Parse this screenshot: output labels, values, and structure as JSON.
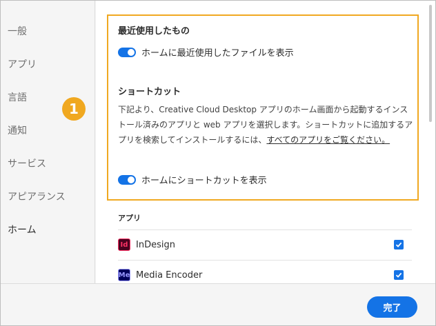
{
  "sidebar": {
    "items": [
      {
        "label": "一般"
      },
      {
        "label": "アプリ"
      },
      {
        "label": "言語"
      },
      {
        "label": "通知"
      },
      {
        "label": "サービス"
      },
      {
        "label": "アピアランス"
      },
      {
        "label": "ホーム",
        "active": true
      }
    ]
  },
  "callout_badge": "1",
  "recent": {
    "title": "最近使用したもの",
    "toggle_label": "ホームに最近使用したファイルを表示",
    "toggle_on": true
  },
  "shortcuts": {
    "title": "ショートカット",
    "description": "下記より、Creative Cloud Desktop アプリのホーム画面から起動するインストール済みのアプリと web アプリを選択します。ショートカットに追加するアプリを検索してインストールするには、",
    "link_text": "すべてのアプリをご覧ください。",
    "toggle_label": "ホームにショートカットを表示",
    "toggle_on": true
  },
  "apps": {
    "header": "アプリ",
    "items": [
      {
        "icon_text": "Id",
        "name": "InDesign",
        "checked": true
      },
      {
        "icon_text": "Me",
        "name": "Media Encoder",
        "checked": true
      }
    ]
  },
  "footer": {
    "done_label": "完了"
  },
  "colors": {
    "accent": "#1473e6",
    "highlight": "#f0a820"
  }
}
